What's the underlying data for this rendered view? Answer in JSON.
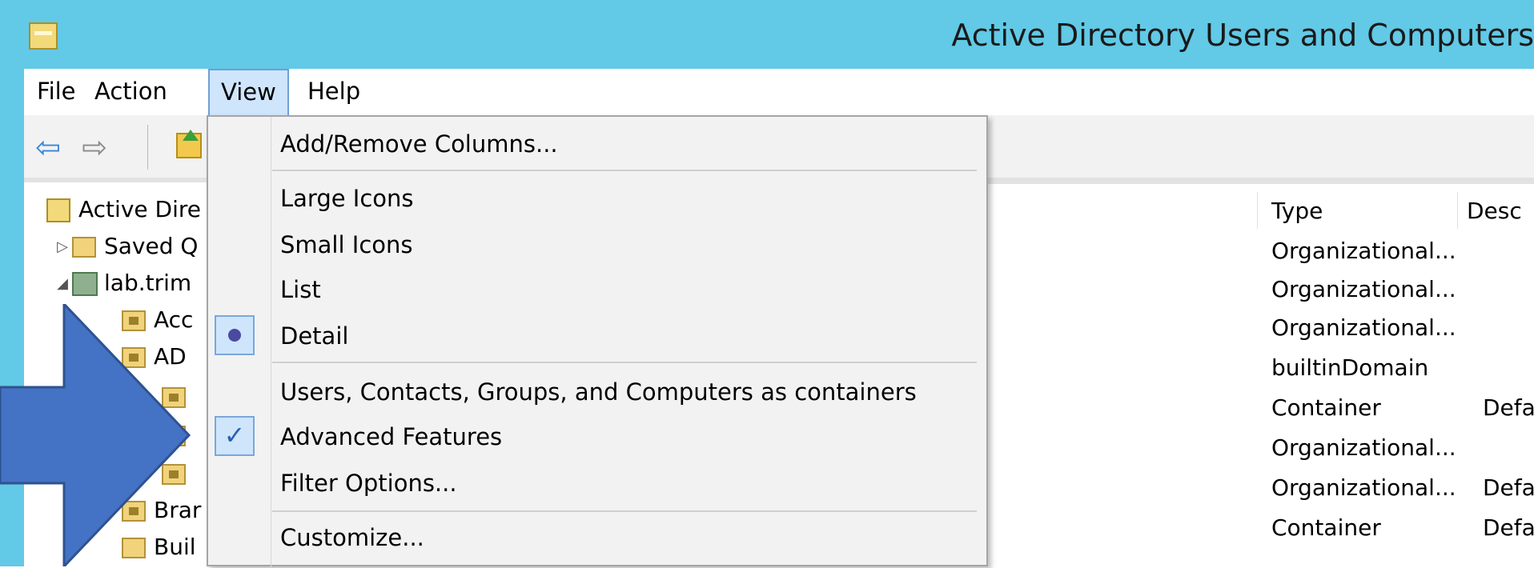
{
  "window": {
    "title": "Active Directory Users and Computers"
  },
  "menubar": {
    "items": [
      "File",
      "Action",
      "View",
      "Help"
    ]
  },
  "toolbar": {
    "icons": [
      "back-arrow-icon",
      "forward-arrow-icon",
      "up-folder-icon",
      "show-console-tree-icon"
    ]
  },
  "tree": {
    "items": [
      {
        "label": "Active Dire",
        "icon": "root-icon"
      },
      {
        "label": "Saved Q",
        "icon": "folder-icon"
      },
      {
        "label": "lab.trim",
        "icon": "domain-icon"
      },
      {
        "label": "Acc",
        "icon": "ou-folder-icon"
      },
      {
        "label": "AD",
        "icon": "ou-folder-icon"
      },
      {
        "label": "",
        "icon": "ou-folder-icon"
      },
      {
        "label": "",
        "icon": "ou-folder-icon"
      },
      {
        "label": "",
        "icon": "ou-folder-icon"
      },
      {
        "label": "Brar",
        "icon": "ou-folder-icon"
      },
      {
        "label": "Buil",
        "icon": "folder-icon"
      }
    ]
  },
  "list": {
    "columns": {
      "type": "Type",
      "description": "Desc"
    },
    "rows": [
      {
        "type": "Organizational...",
        "description": ""
      },
      {
        "type": "Organizational...",
        "description": ""
      },
      {
        "type": "Organizational...",
        "description": ""
      },
      {
        "type": "builtinDomain",
        "description": ""
      },
      {
        "type": "Container",
        "description": "Defa"
      },
      {
        "type": "Organizational...",
        "description": ""
      },
      {
        "type": "Organizational...",
        "description": "Defa"
      },
      {
        "type": "Container",
        "description": "Defa"
      }
    ]
  },
  "view_menu": {
    "add_remove_columns": "Add/Remove Columns...",
    "large_icons": "Large Icons",
    "small_icons": "Small Icons",
    "list": "List",
    "detail": "Detail",
    "containers": "Users, Contacts, Groups, and Computers as containers",
    "advanced_features": "Advanced Features",
    "filter_options": "Filter Options...",
    "customize": "Customize...",
    "selected_view": "Detail",
    "advanced_features_checked": true
  },
  "colors": {
    "titlebar": "#62c9e6",
    "menu_highlight": "#cfe5fb",
    "arrow": "#4472c4"
  }
}
